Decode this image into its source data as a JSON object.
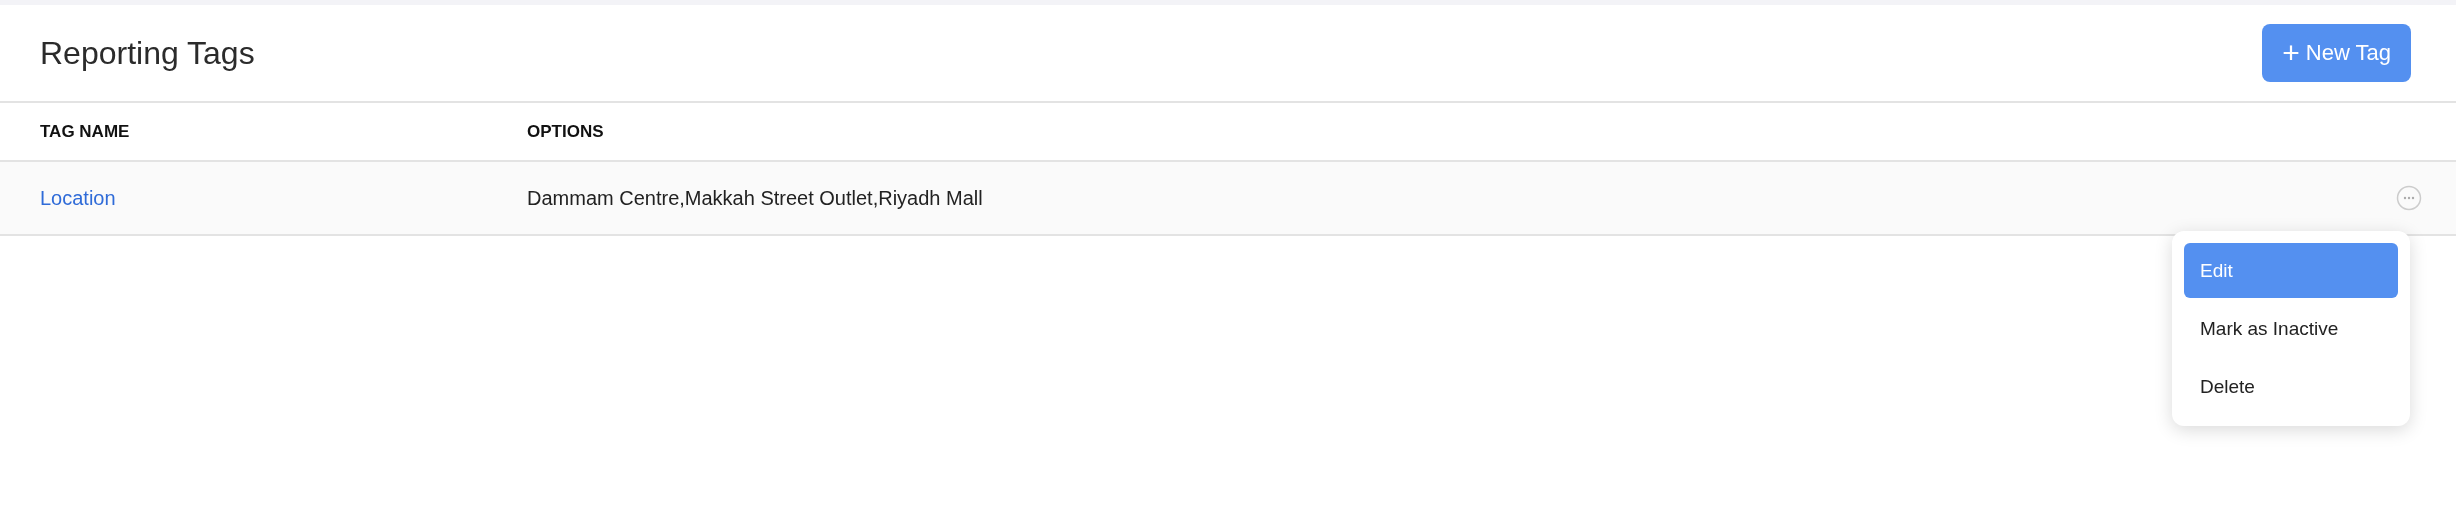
{
  "header": {
    "title": "Reporting Tags",
    "new_button": {
      "icon": "+",
      "label": "New Tag"
    }
  },
  "table": {
    "columns": [
      "TAG NAME",
      "OPTIONS"
    ],
    "rows": [
      {
        "name": "Location",
        "options": "Dammam Centre,Makkah Street Outlet,Riyadh Mall"
      }
    ]
  },
  "menu": {
    "items": [
      {
        "label": "Edit",
        "selected": true
      },
      {
        "label": "Mark as Inactive",
        "selected": false
      },
      {
        "label": "Delete",
        "selected": false
      }
    ]
  }
}
